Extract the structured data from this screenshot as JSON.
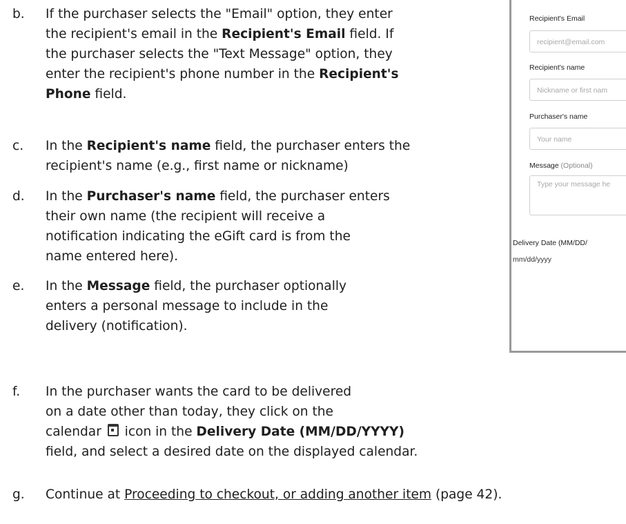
{
  "steps": [
    {
      "marker": "b.",
      "lines": [
        [
          {
            "t": "If the purchaser selects the \"Email\" option, they enter"
          }
        ],
        [
          {
            "t": "the recipient's email in the "
          },
          {
            "t": "Recipient's Email",
            "b": true
          },
          {
            "t": " field.  If"
          }
        ],
        [
          {
            "t": "the purchaser selects the \"Text Message\" option, they"
          }
        ],
        [
          {
            "t": "enter the recipient's phone number in the "
          },
          {
            "t": "Recipient's",
            "b": true
          }
        ],
        [
          {
            "t": "Phone",
            "b": true
          },
          {
            "t": " field."
          }
        ]
      ]
    },
    {
      "marker": "c.",
      "lines": [
        [
          {
            "t": "In the "
          },
          {
            "t": "Recipient's name",
            "b": true
          },
          {
            "t": " field, the purchaser enters the"
          }
        ],
        [
          {
            "t": "recipient's name (e.g., first name or nickname)"
          }
        ]
      ]
    },
    {
      "marker": "d.",
      "lines": [
        [
          {
            "t": "In the "
          },
          {
            "t": "Purchaser's name",
            "b": true
          },
          {
            "t": " field, the purchaser enters"
          }
        ],
        [
          {
            "t": "their own name (the recipient will receive a"
          }
        ],
        [
          {
            "t": "notification indicating the eGift card is from the"
          }
        ],
        [
          {
            "t": " name entered here)."
          }
        ]
      ]
    },
    {
      "marker": "e.",
      "lines": [
        [
          {
            "t": "In the "
          },
          {
            "t": "Message",
            "b": true
          },
          {
            "t": " field, the purchaser optionally"
          }
        ],
        [
          {
            "t": "enters a personal message to include in the"
          }
        ],
        [
          {
            "t": "delivery (notification)."
          }
        ]
      ]
    },
    {
      "marker": "f.",
      "lines": [
        [
          {
            "t": "In the purchaser wants the card to be delivered"
          }
        ],
        [
          {
            "t": "on a date other than today, they click on the"
          }
        ],
        [
          {
            "t": "calendar "
          },
          {
            "icon": "calendar-icon"
          },
          {
            "t": " icon in the "
          },
          {
            "t": "Delivery Date (MM/DD/YYYY)",
            "b": true
          }
        ],
        [
          {
            "t": "field, and select a desired date on the displayed calendar."
          }
        ]
      ]
    },
    {
      "marker": "g.",
      "lines": [
        [
          {
            "t": "Continue at "
          },
          {
            "t": "Proceeding to checkout, or adding another item",
            "u": true
          },
          {
            "t": " (page 42)."
          }
        ]
      ]
    }
  ],
  "form": {
    "recipient_email_label": "Recipient's Email",
    "recipient_email_placeholder": "recipient@email.com",
    "recipient_name_label": "Recipient's name",
    "recipient_name_placeholder": "Nickname or first nam",
    "purchaser_name_label": "Purchaser's name",
    "purchaser_name_placeholder": "Your name",
    "message_label": "Message",
    "message_optional": "(Optional)",
    "message_placeholder": "Type your message he",
    "delivery_date_label": "Delivery Date (MM/DD/",
    "delivery_date_value": "mm/dd/yyyy"
  }
}
